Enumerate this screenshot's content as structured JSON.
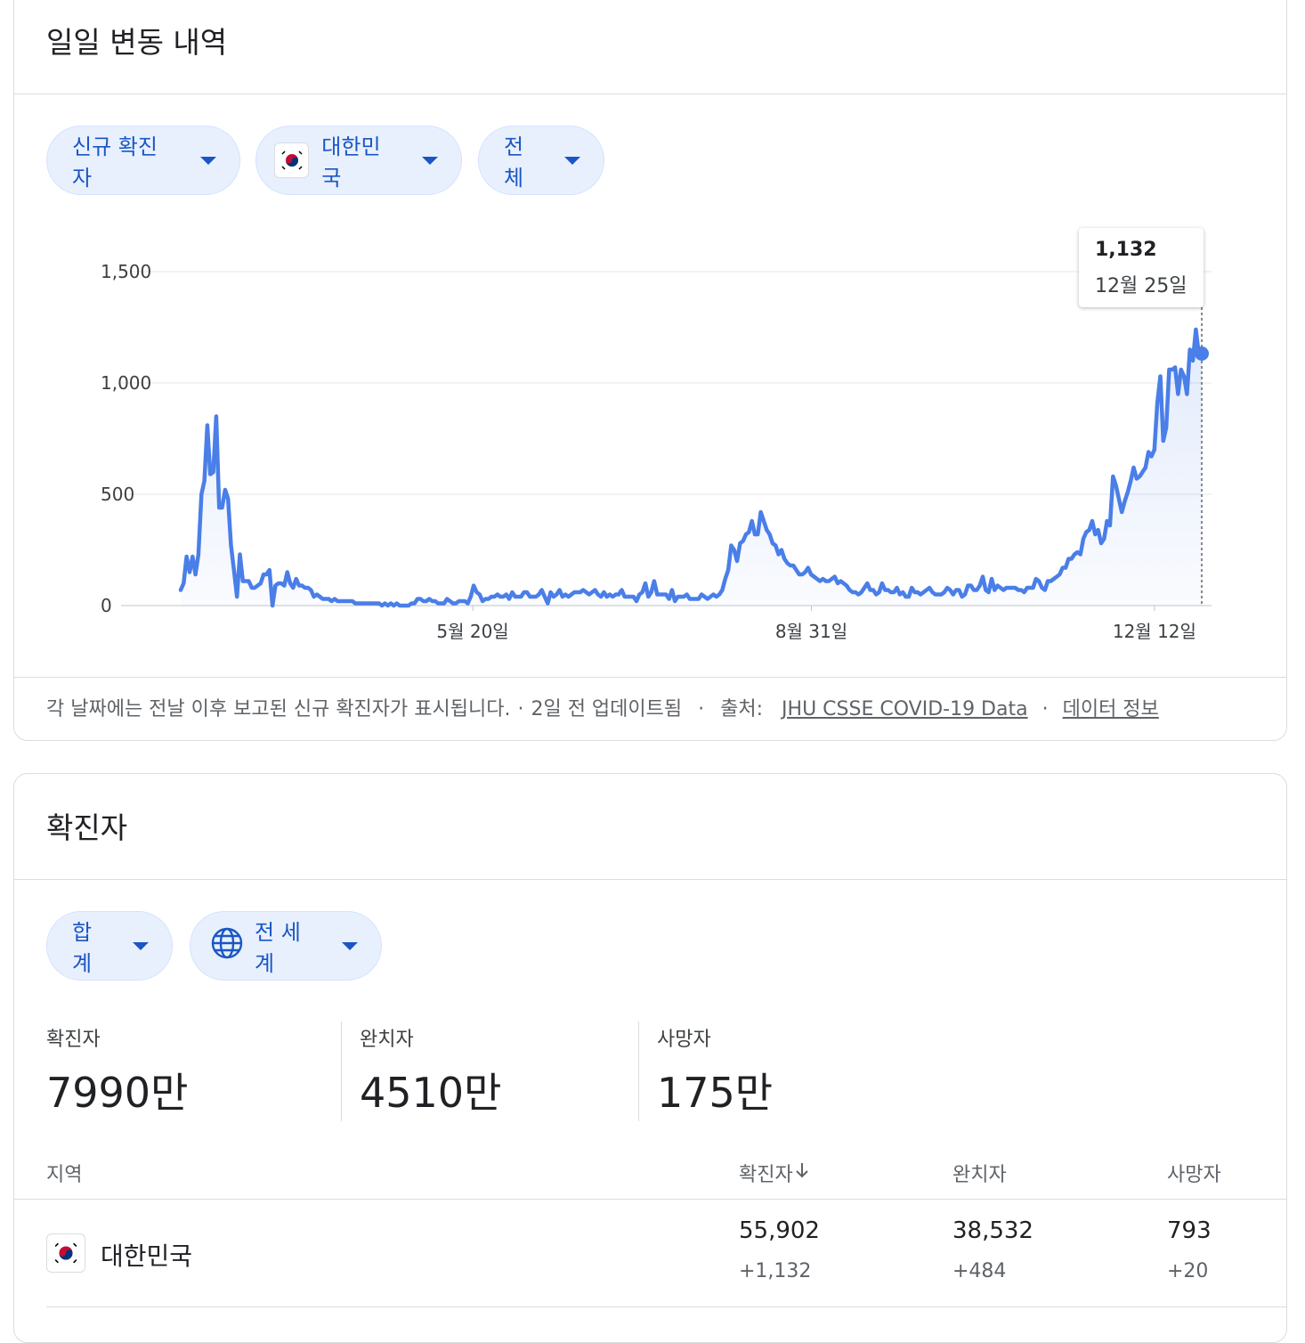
{
  "daily": {
    "title": "일일 변동 내역",
    "chips": {
      "metric": "신규 확진자",
      "country": "대한민국",
      "range": "전체"
    },
    "chart_data": {
      "type": "area",
      "y_ticks": [
        "1,500",
        "1,000",
        "500",
        "0"
      ],
      "x_ticks": [
        "5월 20일",
        "8월 31일",
        "12월 12일"
      ],
      "ylim": [
        0,
        1500
      ],
      "days": 340,
      "values": [
        70,
        100,
        220,
        150,
        220,
        140,
        230,
        500,
        560,
        810,
        590,
        600,
        850,
        440,
        440,
        520,
        480,
        270,
        160,
        40,
        230,
        110,
        110,
        110,
        80,
        80,
        90,
        100,
        140,
        140,
        160,
        0,
        90,
        100,
        100,
        90,
        150,
        100,
        80,
        120,
        90,
        90,
        80,
        80,
        70,
        40,
        50,
        40,
        30,
        30,
        30,
        20,
        30,
        20,
        20,
        20,
        20,
        20,
        20,
        10,
        10,
        10,
        10,
        10,
        10,
        10,
        10,
        10,
        0,
        10,
        0,
        10,
        0,
        10,
        0,
        0,
        0,
        0,
        10,
        10,
        30,
        30,
        20,
        20,
        30,
        20,
        20,
        10,
        10,
        10,
        30,
        20,
        10,
        10,
        20,
        20,
        20,
        10,
        40,
        90,
        60,
        50,
        20,
        30,
        30,
        40,
        40,
        50,
        40,
        40,
        50,
        30,
        60,
        40,
        40,
        40,
        60,
        60,
        40,
        40,
        40,
        50,
        70,
        40,
        10,
        60,
        40,
        50,
        70,
        40,
        50,
        40,
        50,
        60,
        60,
        60,
        70,
        60,
        50,
        60,
        70,
        50,
        40,
        60,
        40,
        50,
        40,
        50,
        50,
        70,
        40,
        40,
        40,
        40,
        20,
        50,
        60,
        100,
        40,
        60,
        110,
        50,
        50,
        50,
        50,
        30,
        70,
        20,
        40,
        40,
        40,
        50,
        30,
        30,
        30,
        30,
        50,
        40,
        30,
        40,
        50,
        40,
        50,
        70,
        120,
        160,
        270,
        250,
        200,
        280,
        290,
        320,
        330,
        380,
        320,
        320,
        420,
        380,
        340,
        320,
        280,
        270,
        230,
        250,
        210,
        190,
        180,
        180,
        160,
        140,
        140,
        150,
        170,
        140,
        130,
        120,
        110,
        120,
        110,
        110,
        120,
        130,
        100,
        110,
        100,
        90,
        70,
        60,
        60,
        50,
        60,
        80,
        100,
        70,
        70,
        50,
        60,
        100,
        70,
        70,
        60,
        60,
        80,
        50,
        60,
        40,
        40,
        80,
        60,
        60,
        50,
        60,
        70,
        80,
        60,
        50,
        50,
        50,
        60,
        80,
        70,
        50,
        70,
        70,
        40,
        50,
        90,
        90,
        70,
        70,
        90,
        130,
        70,
        60,
        120,
        70,
        90,
        80,
        70,
        80,
        80,
        80,
        80,
        70,
        70,
        60,
        80,
        80,
        80,
        120,
        110,
        80,
        70,
        110,
        110,
        120,
        130,
        140,
        170,
        170,
        210,
        210,
        230,
        240,
        230,
        300,
        330,
        340,
        380,
        320,
        340,
        280,
        300,
        380,
        360,
        580,
        540,
        480,
        420,
        470,
        510,
        560,
        620,
        570,
        580,
        600,
        620,
        690,
        670,
        700,
        910,
        1030,
        740,
        800,
        1060,
        1060,
        1070,
        950,
        1060,
        1030,
        950,
        1150,
        1100,
        1240,
        1130,
        1132
      ],
      "highlight": {
        "value": "1,132",
        "date": "12월 25일"
      }
    },
    "footer": {
      "note": "각 날짜에는 전날 이후 보고된 신규 확진자가 표시됩니다.",
      "updated": "2일 전 업데이트됨",
      "source_label": "출처:",
      "source_link": "JHU CSSE COVID-19 Data",
      "info_link": "데이터 정보"
    }
  },
  "cases": {
    "title": "확진자",
    "chips": {
      "scope": "합계",
      "region": "전 세계"
    },
    "stats": [
      {
        "label": "확진자",
        "value": "7990만"
      },
      {
        "label": "완치자",
        "value": "4510만"
      },
      {
        "label": "사망자",
        "value": "175만"
      }
    ],
    "table": {
      "headers": {
        "region": "지역",
        "confirmed": "확진자",
        "recovered": "완치자",
        "deaths": "사망자"
      },
      "sort_icon": "arrow-down-icon",
      "rows": [
        {
          "region": "대한민국",
          "confirmed": "55,902",
          "confirmed_delta": "+1,132",
          "recovered": "38,532",
          "recovered_delta": "+484",
          "deaths": "793",
          "deaths_delta": "+20"
        }
      ]
    }
  },
  "colors": {
    "line": "#4a7ee8",
    "chip_bg": "#e8f0fe",
    "chip_text": "#1a56c4"
  }
}
